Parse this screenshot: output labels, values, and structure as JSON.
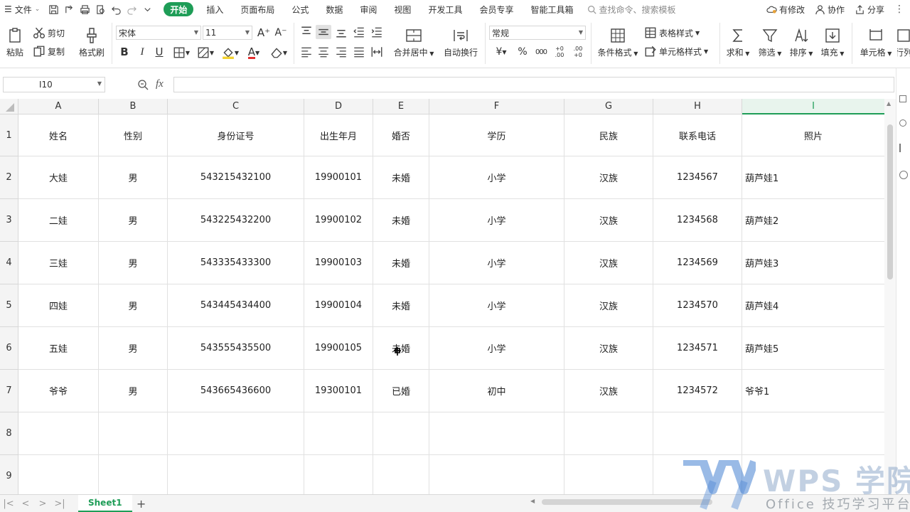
{
  "menubar": {
    "file_label": "文件",
    "tabs": [
      "开始",
      "插入",
      "页面布局",
      "公式",
      "数据",
      "审阅",
      "视图",
      "开发工具",
      "会员专享",
      "智能工具箱"
    ],
    "active_tab": "开始",
    "search_placeholder": "查找命令、搜索模板",
    "right": {
      "changes": "有修改",
      "collab": "协作",
      "share": "分享"
    }
  },
  "ribbon": {
    "paste": "粘贴",
    "cut": "剪切",
    "copy": "复制",
    "format_painter": "格式刷",
    "font_name": "宋体",
    "font_size": "11",
    "merge_center": "合并居中",
    "wrap_text": "自动换行",
    "number_format": "常规",
    "conditional_format": "条件格式",
    "table_style": "表格样式",
    "cell_style": "单元格样式",
    "sum": "求和",
    "filter": "筛选",
    "sort": "排序",
    "fill": "填充",
    "cell": "单元格",
    "rowcol": "行列",
    "currency": "¥",
    "percent": "%",
    "thousands": "000",
    "inc_decimal": "+0 .00",
    "dec_decimal": ".00 +0",
    "bold": "B",
    "italic": "I",
    "underline": "U",
    "font_color_letter": "A"
  },
  "formula_bar": {
    "name_box": "I10",
    "fx": "fx",
    "content": ""
  },
  "columns": [
    "A",
    "B",
    "C",
    "D",
    "E",
    "F",
    "G",
    "H",
    "I"
  ],
  "active_column": "I",
  "rows": [
    "1",
    "2",
    "3",
    "4",
    "5",
    "6",
    "7",
    "8",
    "9"
  ],
  "table": [
    [
      "姓名",
      "性别",
      "身份证号",
      "出生年月",
      "婚否",
      "学历",
      "民族",
      "联系电话",
      "照片"
    ],
    [
      "大娃",
      "男",
      "543215432100",
      "19900101",
      "未婚",
      "小学",
      "汉族",
      "1234567",
      "葫芦娃1"
    ],
    [
      "二娃",
      "男",
      "543225432200",
      "19900102",
      "未婚",
      "小学",
      "汉族",
      "1234568",
      "葫芦娃2"
    ],
    [
      "三娃",
      "男",
      "543335433300",
      "19900103",
      "未婚",
      "小学",
      "汉族",
      "1234569",
      "葫芦娃3"
    ],
    [
      "四娃",
      "男",
      "543445434400",
      "19900104",
      "未婚",
      "小学",
      "汉族",
      "1234570",
      "葫芦娃4"
    ],
    [
      "五娃",
      "男",
      "543555435500",
      "19900105",
      "未婚",
      "小学",
      "汉族",
      "1234571",
      "葫芦娃5"
    ],
    [
      "爷爷",
      "男",
      "543665436600",
      "19300101",
      "已婚",
      "初中",
      "汉族",
      "1234572",
      "爷爷1"
    ],
    [
      "",
      "",
      "",
      "",
      "",
      "",
      "",
      "",
      ""
    ],
    [
      "",
      "",
      "",
      "",
      "",
      "",
      "",
      "",
      ""
    ]
  ],
  "sheets": {
    "tabs": [
      "Sheet1"
    ],
    "active": "Sheet1",
    "add": "+"
  },
  "watermark": {
    "title": "WPS 学院",
    "subtitle": "Office 技巧学习平台"
  },
  "colors": {
    "accent": "#1e9d57",
    "header_bg": "#f4f4f4",
    "grid": "#e1e1e1"
  }
}
